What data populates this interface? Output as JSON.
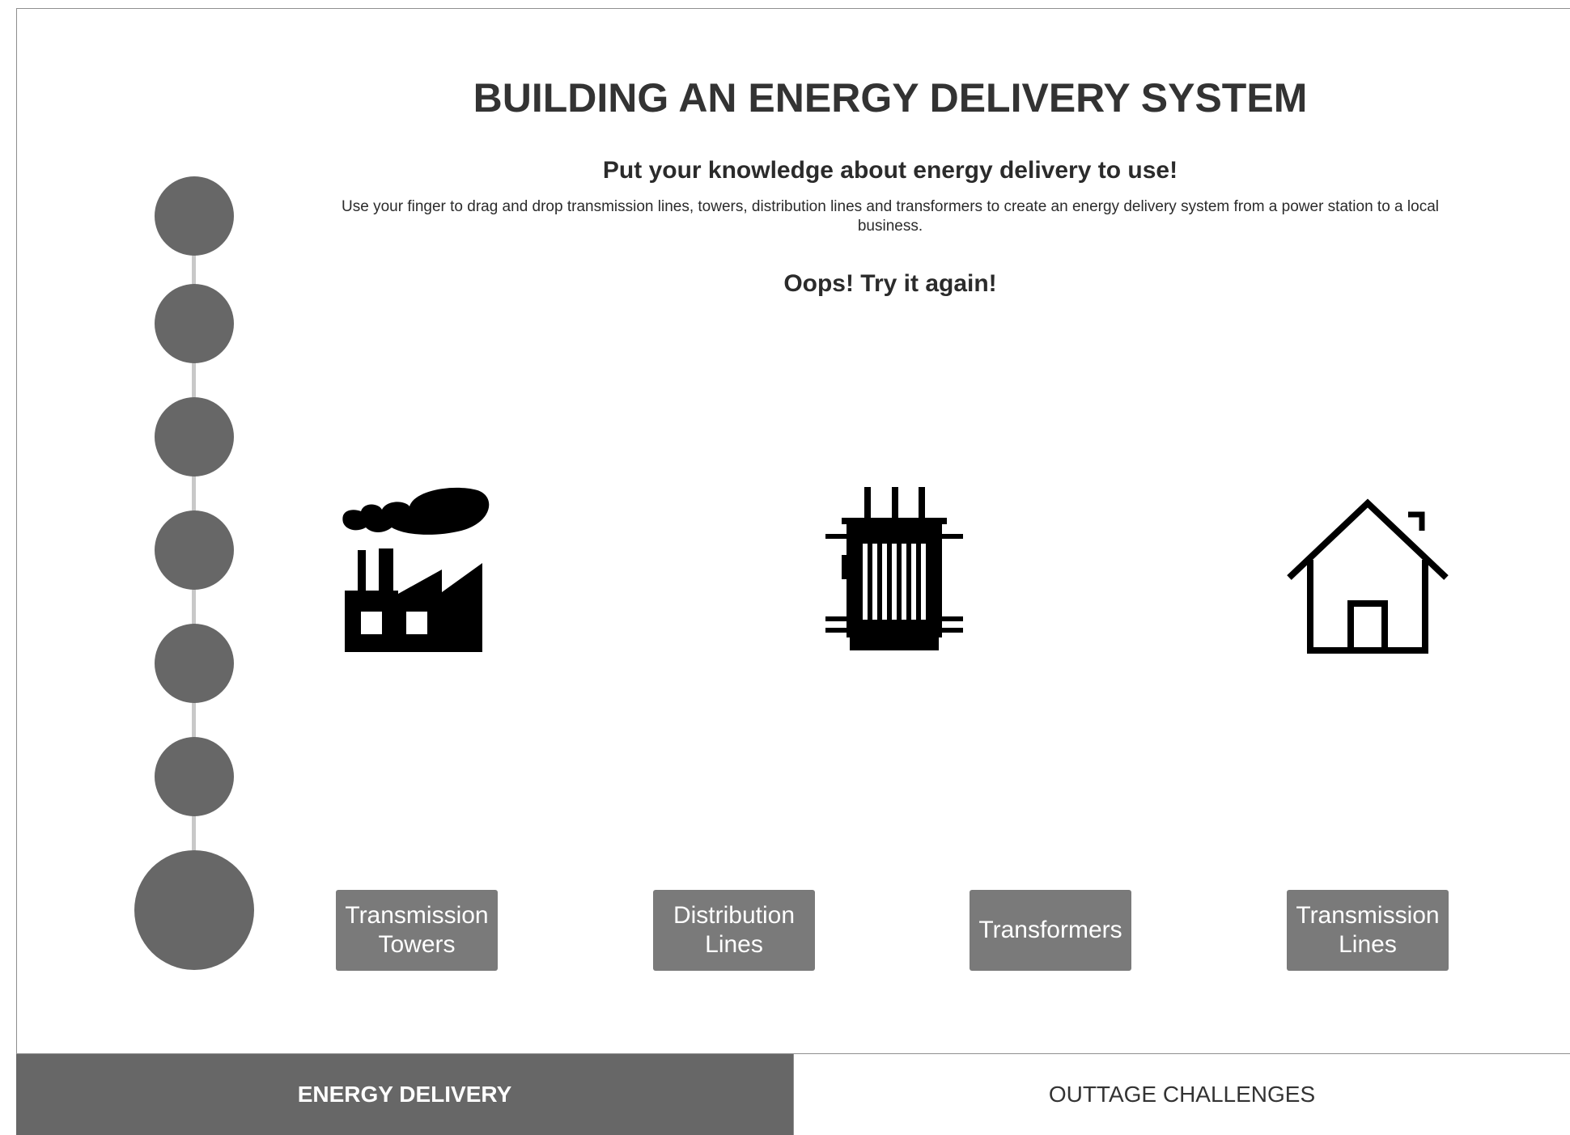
{
  "page": {
    "title": "BUILDING AN ENERGY DELIVERY SYSTEM",
    "subtitle": "Put your knowledge about energy delivery to use!",
    "instructions": "Use your finger to drag and drop transmission lines, towers, distribution lines and transformers to create an energy delivery system from a power station to a local business.",
    "feedback": "Oops! Try it again!"
  },
  "progress": {
    "total_steps": 7,
    "current_step": 7
  },
  "diagram": {
    "icons": [
      "factory-icon",
      "transformer-icon",
      "house-icon"
    ]
  },
  "choices": [
    {
      "line1": "Transmission",
      "line2": "Towers"
    },
    {
      "line1": "Distribution",
      "line2": "Lines"
    },
    {
      "line1": "Transformers",
      "line2": ""
    },
    {
      "line1": "Transmission",
      "line2": "Lines"
    }
  ],
  "tabs": {
    "active": "ENERGY DELIVERY",
    "inactive": "OUTTAGE CHALLENGES"
  },
  "colors": {
    "step": "#676767",
    "button": "#7a7a7a",
    "active_tab": "#676767",
    "line": "#c8c8c8"
  }
}
